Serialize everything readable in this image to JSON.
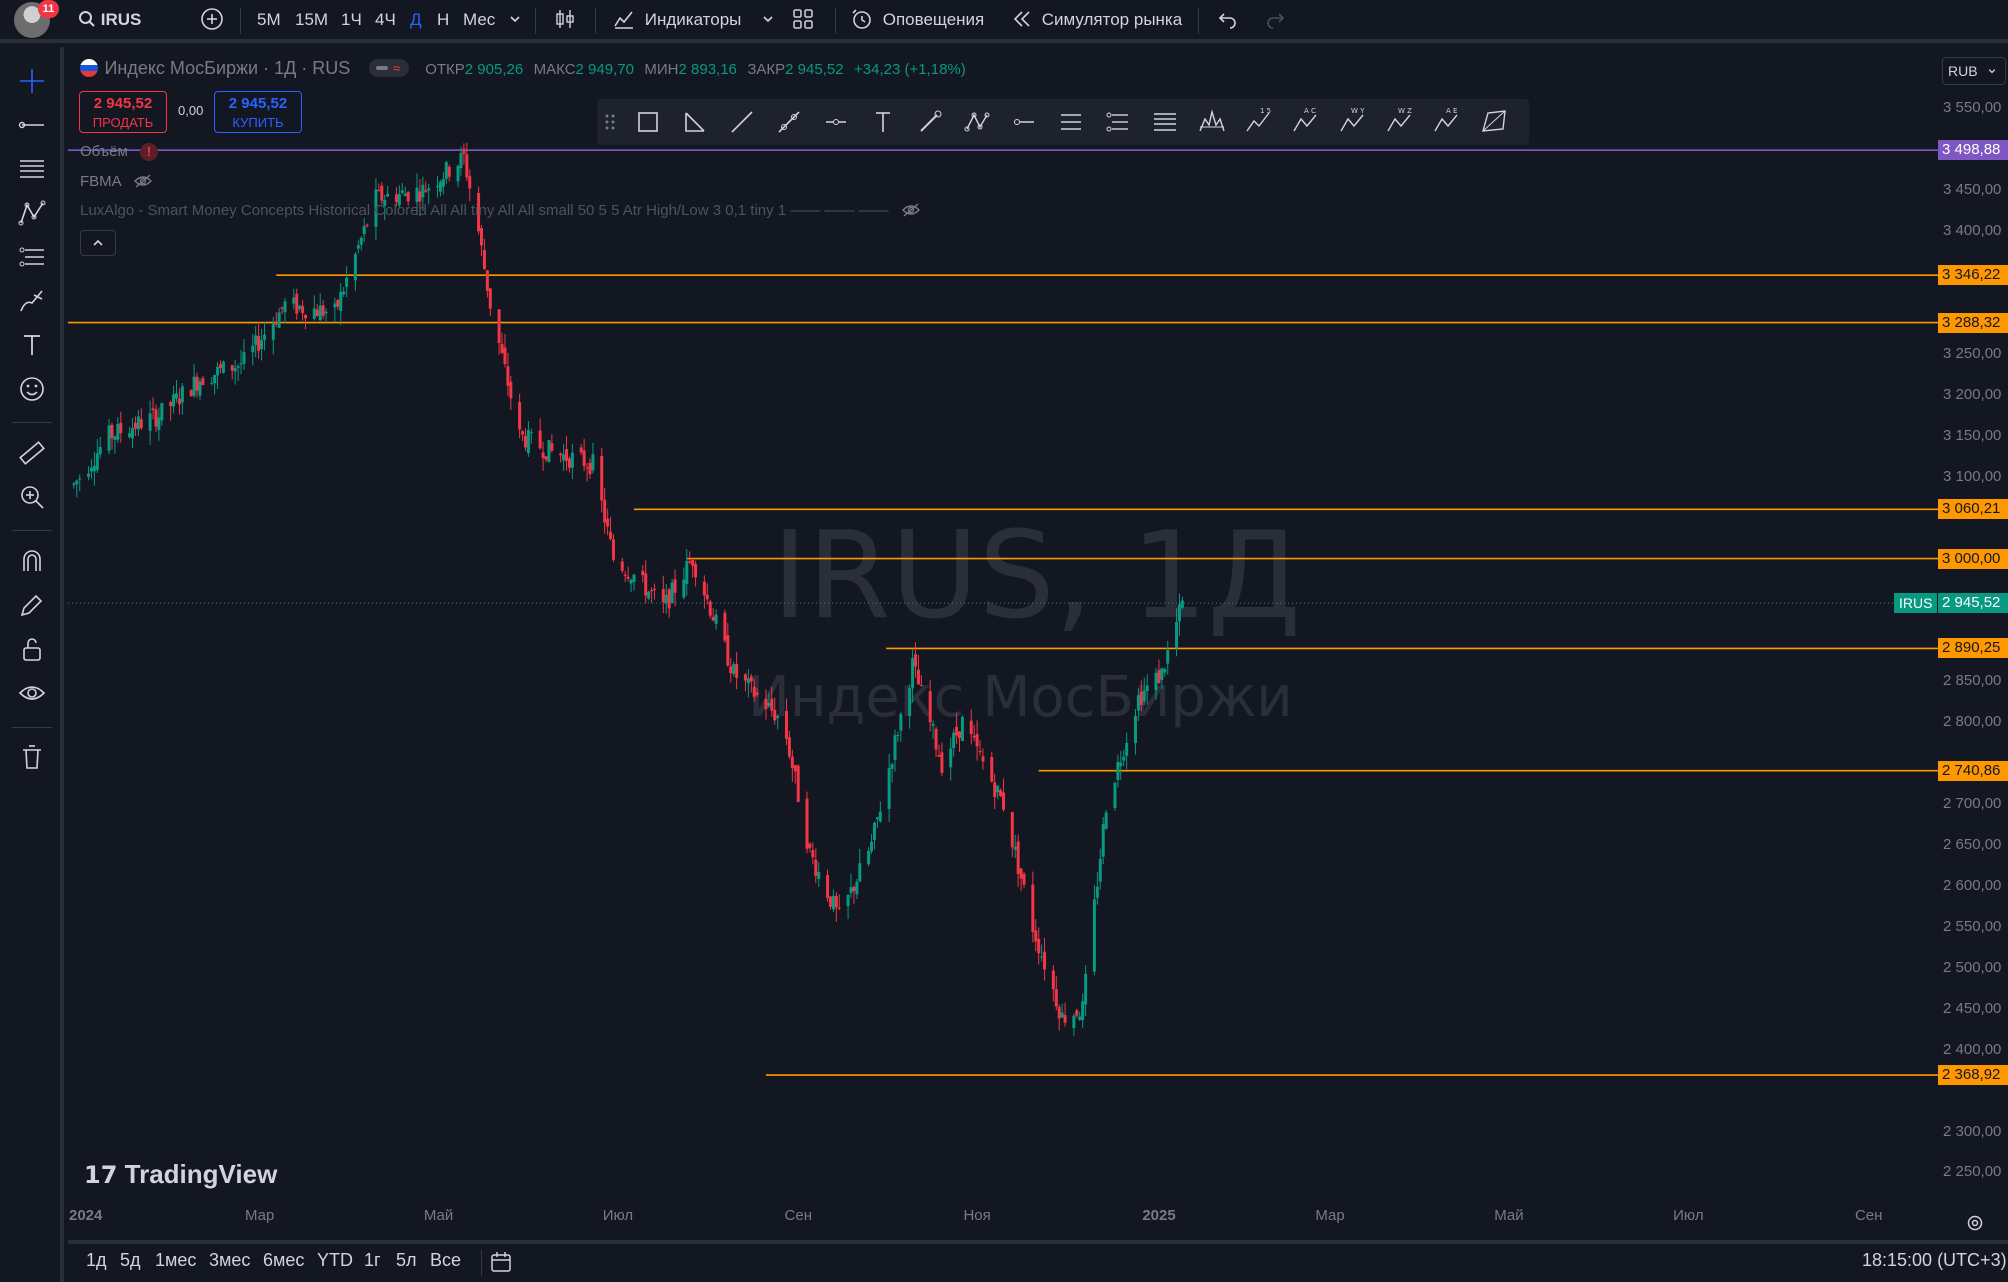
{
  "header": {
    "notification_count": "11",
    "symbol": "IRUS",
    "intervals": [
      "5М",
      "15М",
      "1Ч",
      "4Ч",
      "Д",
      "Н",
      "Мес"
    ],
    "active_interval": "Д",
    "indicators_label": "Индикаторы",
    "alerts_label": "Оповещения",
    "replay_label": "Симулятор рынка"
  },
  "legend": {
    "title": "Индекс МосБиржи · 1Д · RUS",
    "open_label": "ОТКР",
    "open_value": "2 905,26",
    "high_label": "МАКС",
    "high_value": "2 949,70",
    "low_label": "МИН",
    "low_value": "2 893,16",
    "close_label": "ЗАКР",
    "close_value": "2 945,52",
    "change_value": "+34,23 (+1,18%)",
    "sell_price": "2 945,52",
    "sell_label": "ПРОДАТЬ",
    "spread": "0,00",
    "buy_price": "2 945,52",
    "buy_label": "КУПИТЬ",
    "indicator_volume": "Объём",
    "indicator_fbma": "FBMA",
    "indicator_luxalgo": "LuxAlgo - Smart Money Concepts Historical Colored All All tiny All All small 50 5 5 Atr High/Low 3 0,1 tiny 1 —— —— ——"
  },
  "currency": "RUB",
  "watermark": {
    "line1": "IRUS, 1Д",
    "line2": "Индекс МосБиржи"
  },
  "brand": "TradingView",
  "price_scale": {
    "min": 2220,
    "max": 3625,
    "ticks": [
      {
        "value": 3550,
        "label": "3 550,00"
      },
      {
        "value": 3450,
        "label": "3 450,00"
      },
      {
        "value": 3400,
        "label": "3 400,00"
      },
      {
        "value": 3250,
        "label": "3 250,00"
      },
      {
        "value": 3200,
        "label": "3 200,00"
      },
      {
        "value": 3150,
        "label": "3 150,00"
      },
      {
        "value": 3100,
        "label": "3 100,00"
      },
      {
        "value": 2850,
        "label": "2 850,00"
      },
      {
        "value": 2800,
        "label": "2 800,00"
      },
      {
        "value": 2700,
        "label": "2 700,00"
      },
      {
        "value": 2650,
        "label": "2 650,00"
      },
      {
        "value": 2600,
        "label": "2 600,00"
      },
      {
        "value": 2550,
        "label": "2 550,00"
      },
      {
        "value": 2500,
        "label": "2 500,00"
      },
      {
        "value": 2450,
        "label": "2 450,00"
      },
      {
        "value": 2400,
        "label": "2 400,00"
      },
      {
        "value": 2300,
        "label": "2 300,00"
      },
      {
        "value": 2250,
        "label": "2 250,00"
      }
    ]
  },
  "levels": [
    {
      "value": 3498.88,
      "label": "3 498,88",
      "color": "#7e57c2",
      "start": "2024-01-01"
    },
    {
      "value": 3346.22,
      "label": "3 346,22",
      "color": "#ff9800",
      "start": "2024-03-12"
    },
    {
      "value": 3288.32,
      "label": "3 288,32",
      "color": "#ff9800",
      "start": "2024-01-01"
    },
    {
      "value": 3060.21,
      "label": "3 060,21",
      "color": "#ff9800",
      "start": "2024-07-12"
    },
    {
      "value": 3000.0,
      "label": "3 000,00",
      "color": "#ff9800",
      "start": "2024-07-30"
    },
    {
      "value": 2890.25,
      "label": "2 890,25",
      "color": "#ff9800",
      "start": "2024-10-06"
    },
    {
      "value": 2740.86,
      "label": "2 740,86",
      "color": "#ff9800",
      "start": "2024-11-27"
    },
    {
      "value": 2368.92,
      "label": "2 368,92",
      "color": "#ff9800",
      "start": "2024-08-26"
    }
  ],
  "last_price": {
    "value": 2945.52,
    "label": "2 945,52",
    "ticker": "IRUS",
    "color": "#089981"
  },
  "time_axis": {
    "start": "2024-01-01",
    "end": "2025-09-30",
    "labels": [
      {
        "date": "2024-01-01",
        "label": "2024"
      },
      {
        "date": "2024-03-01",
        "label": "Мар"
      },
      {
        "date": "2024-05-01",
        "label": "Май"
      },
      {
        "date": "2024-07-01",
        "label": "Июл"
      },
      {
        "date": "2024-09-01",
        "label": "Сен"
      },
      {
        "date": "2024-11-01",
        "label": "Ноя"
      },
      {
        "date": "2025-01-01",
        "label": "2025"
      },
      {
        "date": "2025-03-01",
        "label": "Мар"
      },
      {
        "date": "2025-05-01",
        "label": "Май"
      },
      {
        "date": "2025-07-01",
        "label": "Июл"
      },
      {
        "date": "2025-09-01",
        "label": "Сен"
      }
    ]
  },
  "chart_data": {
    "type": "line",
    "title": "Индекс МосБиржи · 1Д · RUS",
    "xlabel": "",
    "ylabel": "",
    "ylim": [
      2220,
      3625
    ],
    "series": [
      {
        "name": "IRUS",
        "x": [
          "2024-01-03",
          "2024-01-15",
          "2024-02-01",
          "2024-02-15",
          "2024-03-01",
          "2024-03-15",
          "2024-04-01",
          "2024-04-15",
          "2024-05-01",
          "2024-05-15",
          "2024-05-20",
          "2024-05-24",
          "2024-06-03",
          "2024-06-14",
          "2024-06-28",
          "2024-07-05",
          "2024-07-12",
          "2024-07-22",
          "2024-08-01",
          "2024-08-15",
          "2024-09-01",
          "2024-09-10",
          "2024-09-20",
          "2024-10-01",
          "2024-10-15",
          "2024-10-25",
          "2024-11-01",
          "2024-11-15",
          "2024-11-25",
          "2024-12-05",
          "2024-12-12",
          "2024-12-20",
          "2024-12-31",
          "2025-01-08",
          "2025-01-15"
        ],
        "y": [
          3090,
          3150,
          3175,
          3220,
          3240,
          3310,
          3300,
          3440,
          3450,
          3490,
          3400,
          3310,
          3150,
          3130,
          3115,
          3000,
          2980,
          2940,
          3000,
          2860,
          2800,
          2640,
          2560,
          2650,
          2870,
          2750,
          2800,
          2700,
          2550,
          2440,
          2450,
          2700,
          2830,
          2860,
          2945
        ]
      }
    ]
  },
  "bottom": {
    "ranges": [
      "1д",
      "5д",
      "1мес",
      "3мес",
      "6мес",
      "YTD",
      "1г",
      "5л",
      "Все"
    ],
    "time": "18:15:00 (UTC+3)"
  }
}
